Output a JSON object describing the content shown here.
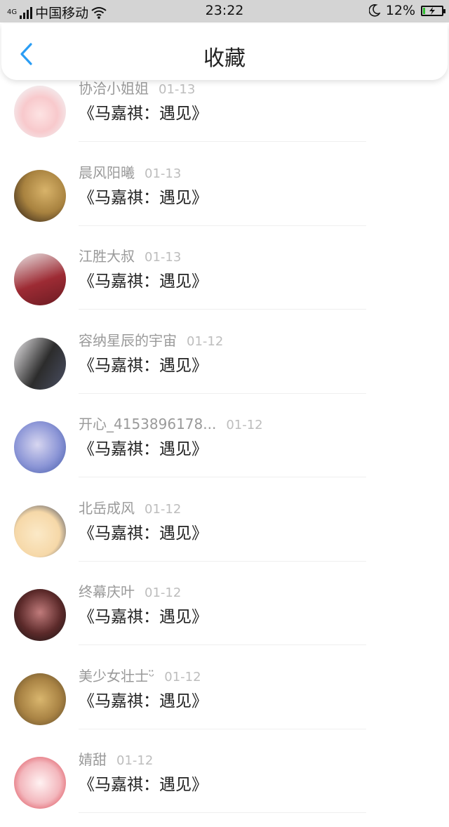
{
  "status_bar": {
    "network": "4G",
    "carrier": "中国移动",
    "time": "23:22",
    "battery": "12%",
    "battery_level": 0.12,
    "icons": [
      "signal-icon",
      "wifi-icon",
      "moon-icon",
      "battery-icon"
    ]
  },
  "header": {
    "title": "收藏",
    "back_icon": "chevron-left-icon",
    "accent_color": "#2a9df4"
  },
  "items": [
    {
      "user": "协洽小姐姐",
      "date": "01-13",
      "title": "《马嘉祺：遇见》"
    },
    {
      "user": "晨风阳曦",
      "date": "01-13",
      "title": "《马嘉祺：遇见》"
    },
    {
      "user": "江胜大叔",
      "date": "01-13",
      "title": "《马嘉祺：遇见》"
    },
    {
      "user": "容纳星辰的宇宙",
      "date": "01-12",
      "title": "《马嘉祺：遇见》"
    },
    {
      "user": "开心_4153896178...",
      "date": "01-12",
      "title": "《马嘉祺：遇见》"
    },
    {
      "user": "北岳成风",
      "date": "01-12",
      "title": "《马嘉祺：遇见》"
    },
    {
      "user": "终幕庆叶",
      "date": "01-12",
      "title": "《马嘉祺：遇见》"
    },
    {
      "user": "美少女壮士ᵕ̈",
      "date": "01-12",
      "title": "《马嘉祺：遇见》"
    },
    {
      "user": "婧甜",
      "date": "01-12",
      "title": "《马嘉祺：遇见》"
    }
  ]
}
